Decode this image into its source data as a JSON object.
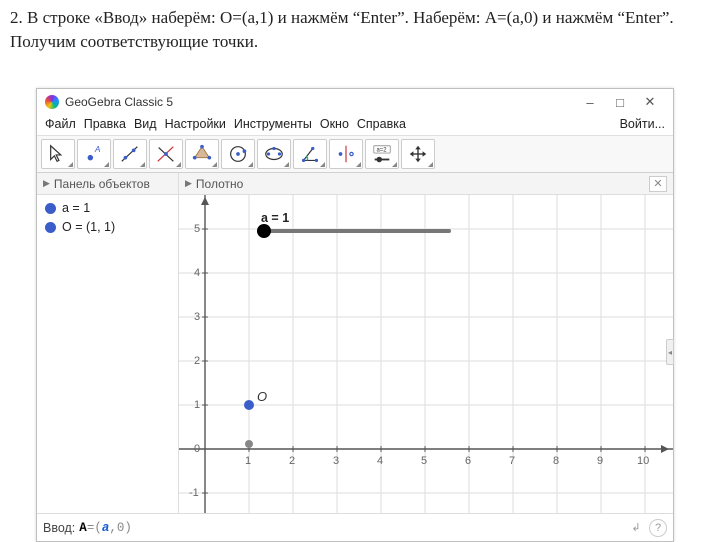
{
  "instruction_text": "2. В строке «Ввод» наберём: O=(a,1) и нажмём “Enter”. Наберём: A=(a,0) и нажмём “Enter”. Получим соответствующие точки.",
  "window": {
    "title": "GeoGebra Classic 5",
    "btn_min": "–",
    "btn_max": "□",
    "btn_close": "✕",
    "login": "Войти..."
  },
  "menu": {
    "file": "Файл",
    "edit": "Правка",
    "view": "Вид",
    "options": "Настройки",
    "tools": "Инструменты",
    "window": "Окно",
    "help": "Справка"
  },
  "toolbar": {
    "slider_badge": "a=2"
  },
  "sidebar": {
    "header": "Панель объектов",
    "items": [
      {
        "label": "a = 1"
      },
      {
        "label": "O = (1, 1)"
      }
    ]
  },
  "graphics": {
    "header": "Полотно",
    "close": "✕"
  },
  "slider": {
    "label": "a = 1"
  },
  "points": {
    "O": "O"
  },
  "axis": {
    "x": [
      "1",
      "2",
      "3",
      "4",
      "5",
      "6",
      "7",
      "8",
      "9",
      "10"
    ],
    "y": [
      "-1",
      "0",
      "1",
      "2",
      "3",
      "4",
      "5"
    ]
  },
  "input": {
    "label": "Ввод:",
    "prefix": "A",
    "mid": "=(",
    "var": "a",
    "tail": ",0)",
    "enter": "↲",
    "help": "?"
  },
  "chart_data": {
    "type": "scatter",
    "title": "",
    "xlabel": "",
    "ylabel": "",
    "xlim": [
      -0.5,
      10.5
    ],
    "ylim": [
      -1.5,
      5.5
    ],
    "parameters": {
      "a": 1
    },
    "series": [
      {
        "name": "O",
        "x": [
          1
        ],
        "y": [
          1
        ]
      }
    ],
    "extras": {
      "slider": {
        "name": "a",
        "value": 1,
        "unlabeled_knob_at_x": 1,
        "track_pixels": 190
      },
      "loose_point_at": {
        "x": 1,
        "y": 0.1
      }
    }
  }
}
